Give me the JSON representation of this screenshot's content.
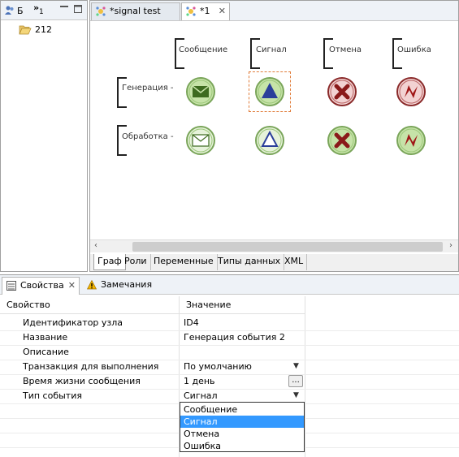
{
  "left_panel": {
    "tab1_label": "Б",
    "tab2_label": "»",
    "tab2_count": "1",
    "tree_item": "212"
  },
  "editor": {
    "tabs": [
      {
        "label": "*signal test",
        "active": false
      },
      {
        "label": "*1",
        "active": true
      }
    ],
    "columns": [
      "Сообщение",
      "Сигнал",
      "Отмена",
      "Ошибка"
    ],
    "rows": [
      "Генерация -",
      "Обработка -"
    ],
    "bottom_tabs": [
      "Граф",
      "Роли",
      "Переменные",
      "Типы данных",
      "XML"
    ],
    "active_bottom_tab": "Граф"
  },
  "properties": {
    "tabs": [
      {
        "label": "Свойства",
        "active": true
      },
      {
        "label": "Замечания",
        "active": false
      }
    ],
    "header": {
      "property": "Свойство",
      "value": "Значение"
    },
    "rows": [
      {
        "name": "Идентификатор узла",
        "value": "ID4"
      },
      {
        "name": "Название",
        "value": "Генерация события 2"
      },
      {
        "name": "Описание",
        "value": ""
      },
      {
        "name": "Транзакция для выполнения",
        "value": "По умолчанию"
      },
      {
        "name": "Время жизни сообщения",
        "value": "1 день"
      },
      {
        "name": "Тип события",
        "value": "Сигнал"
      }
    ],
    "ellipsis": "...",
    "dropdown_options": [
      "Сообщение",
      "Сигнал",
      "Отмена",
      "Ошибка"
    ],
    "dropdown_selected": "Сигнал"
  },
  "colors": {
    "node_fill": "#c6e3a8",
    "node_border": "#7aa55a",
    "selection": "#e07b39",
    "highlight": "#3399ff"
  }
}
